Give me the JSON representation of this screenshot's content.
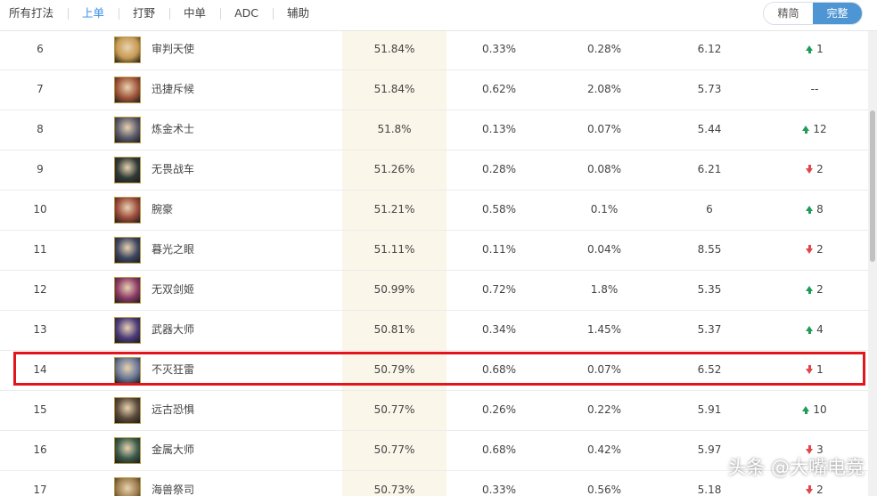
{
  "tabs": [
    {
      "label": "所有打法",
      "active": false
    },
    {
      "label": "上单",
      "active": true
    },
    {
      "label": "打野",
      "active": false
    },
    {
      "label": "中单",
      "active": false
    },
    {
      "label": "ADC",
      "active": false
    },
    {
      "label": "辅助",
      "active": false
    }
  ],
  "view_toggle": {
    "simple": "精简",
    "full": "完整",
    "selected": "完整"
  },
  "rows": [
    {
      "rank": "6",
      "hero": "审判天使",
      "win": "51.84%",
      "pick": "0.33%",
      "ban": "0.28%",
      "kda": "6.12",
      "trend": "up",
      "change": "1",
      "avatar": "#c79a52"
    },
    {
      "rank": "7",
      "hero": "迅捷斥候",
      "win": "51.84%",
      "pick": "0.62%",
      "ban": "2.08%",
      "kda": "5.73",
      "trend": "flat",
      "change": "--",
      "avatar": "#a0553a"
    },
    {
      "rank": "8",
      "hero": "炼金术士",
      "win": "51.8%",
      "pick": "0.13%",
      "ban": "0.07%",
      "kda": "5.44",
      "trend": "up",
      "change": "12",
      "avatar": "#5a5a6a"
    },
    {
      "rank": "9",
      "hero": "无畏战车",
      "win": "51.26%",
      "pick": "0.28%",
      "ban": "0.08%",
      "kda": "6.21",
      "trend": "down",
      "change": "2",
      "avatar": "#2f3a35"
    },
    {
      "rank": "10",
      "hero": "腕豪",
      "win": "51.21%",
      "pick": "0.58%",
      "ban": "0.1%",
      "kda": "6",
      "trend": "up",
      "change": "8",
      "avatar": "#9a4a3a"
    },
    {
      "rank": "11",
      "hero": "暮光之眼",
      "win": "51.11%",
      "pick": "0.11%",
      "ban": "0.04%",
      "kda": "8.55",
      "trend": "down",
      "change": "2",
      "avatar": "#3d4660"
    },
    {
      "rank": "12",
      "hero": "无双剑姬",
      "win": "50.99%",
      "pick": "0.72%",
      "ban": "1.8%",
      "kda": "5.35",
      "trend": "up",
      "change": "2",
      "avatar": "#8a3a66"
    },
    {
      "rank": "13",
      "hero": "武器大师",
      "win": "50.81%",
      "pick": "0.34%",
      "ban": "1.45%",
      "kda": "5.37",
      "trend": "up",
      "change": "4",
      "avatar": "#4a3a7a"
    },
    {
      "rank": "14",
      "hero": "不灭狂雷",
      "win": "50.79%",
      "pick": "0.68%",
      "ban": "0.07%",
      "kda": "6.52",
      "trend": "down",
      "change": "1",
      "avatar": "#6a7898"
    },
    {
      "rank": "15",
      "hero": "远古恐惧",
      "win": "50.77%",
      "pick": "0.26%",
      "ban": "0.22%",
      "kda": "5.91",
      "trend": "up",
      "change": "10",
      "avatar": "#5a4a3a"
    },
    {
      "rank": "16",
      "hero": "金属大师",
      "win": "50.77%",
      "pick": "0.68%",
      "ban": "0.42%",
      "kda": "5.97",
      "trend": "down",
      "change": "3",
      "avatar": "#3a5a4a"
    },
    {
      "rank": "17",
      "hero": "海兽祭司",
      "win": "50.73%",
      "pick": "0.33%",
      "ban": "0.56%",
      "kda": "5.18",
      "trend": "down",
      "change": "2",
      "avatar": "#9a7a4a"
    }
  ],
  "watermark": "头条 @大嘴电竞"
}
